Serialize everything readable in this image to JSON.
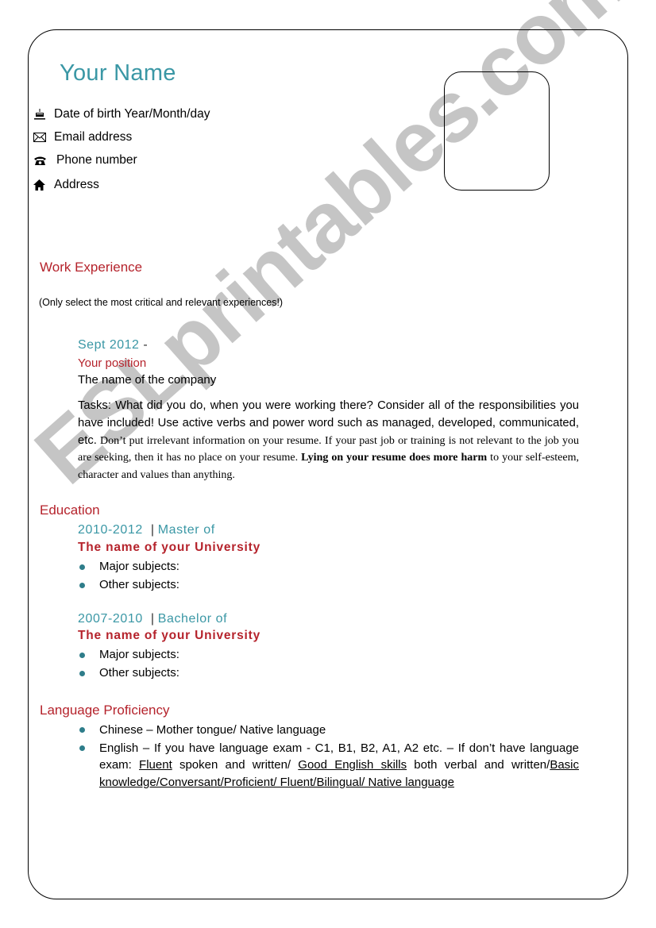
{
  "header": {
    "name": "Your Name",
    "contacts": [
      {
        "icon": "birthday-cake-icon",
        "text": "Date of birth Year/Month/day"
      },
      {
        "icon": "envelope-icon",
        "text": "Email address"
      },
      {
        "icon": "telephone-icon",
        "text": "Phone number"
      },
      {
        "icon": "home-icon",
        "text": "Address"
      }
    ]
  },
  "work": {
    "title": "Work Experience",
    "note": "(Only select the most critical and relevant experiences!)",
    "date": "Sept 2012",
    "date_suffix": " -",
    "position": "Your position",
    "company": "The name of the company",
    "tasks_sans": "Tasks: What did you do, when you were working there?  Consider all of the responsibilities you have included! Use active verbs and power word such as managed, developed, communicated, etc.",
    "tasks_serif": " Don’t put irrelevant information on your resume. If your past job or training is not relevant to the job you are seeking, then it has no place on your resume.  ",
    "tasks_bold": "Lying on your resume does more harm",
    "tasks_end": " to your self-esteem, character and values than anything."
  },
  "education": {
    "title": "Education",
    "entries": [
      {
        "years": "2010-2012",
        "degree": "Master of",
        "university": "The name of your University",
        "bullets": [
          "Major subjects:",
          "Other subjects:"
        ]
      },
      {
        "years": "2007-2010",
        "degree": "Bachelor of",
        "university": "The name of your University",
        "bullets": [
          "Major subjects:",
          "Other subjects:"
        ]
      }
    ]
  },
  "language": {
    "title": "Language Proficiency",
    "item1": "Chinese – Mother tongue/ Native language",
    "item2_a": "English – If you have language exam - C1, B1, B2, A1, A2 etc. – If don’t have language exam: ",
    "item2_u1": "Fluent",
    "item2_b": " spoken and written/ ",
    "item2_u2": "Good English skills",
    "item2_c": " both verbal and written/",
    "item2_u3": "Basic knowledge/Conversant/Proficient/ Fluent/Bilingual/ Native language"
  },
  "watermark": "ESLprintables.com",
  "colors": {
    "accent_teal": "#3a97a5",
    "accent_red": "#b5232c",
    "bullet": "#2e7d8a"
  }
}
